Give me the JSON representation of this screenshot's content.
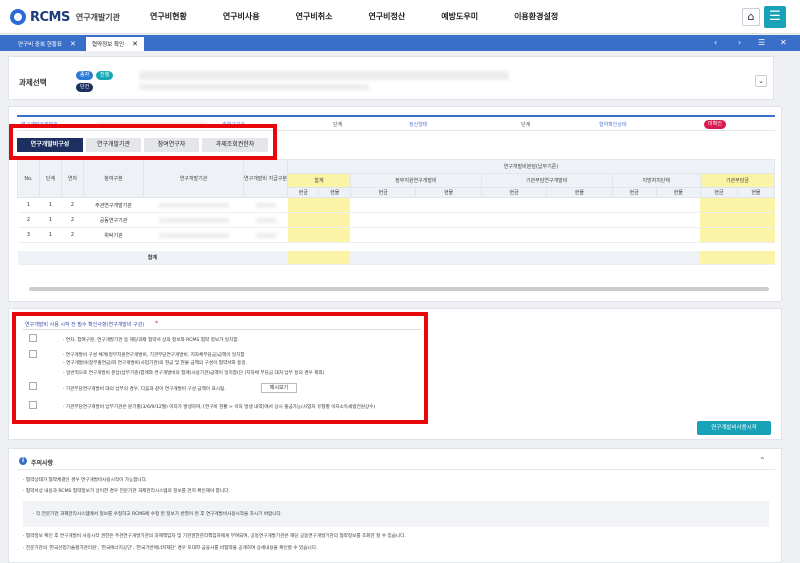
{
  "brand": {
    "name": "RCMS",
    "sub": "연구개발기관"
  },
  "menu": [
    "연구비현황",
    "연구비사용",
    "연구비취소",
    "연구비정산",
    "예방도우미",
    "이용환경설정"
  ],
  "tabs": [
    {
      "label": "연구비 중복 현황표",
      "active": false
    },
    {
      "label": "협약정보 확인",
      "active": true
    }
  ],
  "header": {
    "title": "과제선택",
    "badges": [
      {
        "label": "종자",
        "color": "#2b7bd6"
      },
      {
        "label": "진행",
        "color": "#19a9b5"
      },
      {
        "label": "단건",
        "color": "#1d2f5e"
      }
    ]
  },
  "info": {
    "lbl1": "연구개발과제번호",
    "lbl2": "총연구기간",
    "lbl3": "정산형태",
    "val3": "단계",
    "lbl4": "협약확인상태",
    "val4": "미확인",
    "lbl2b": "단계"
  },
  "subtabs": [
    "연구개발비구성",
    "연구개발기관",
    "참여연구자",
    "과제조회권한자"
  ],
  "table": {
    "group_top": "연구개발비분담(납부기준)",
    "cols": [
      "No.",
      "단계",
      "연차",
      "참여구분",
      "연구개발기관",
      "연구개발비 지급구분"
    ],
    "sub_cols": [
      "합계",
      "정부지원연구개발비",
      "기관부담연구개발비",
      "지방자치단체",
      "기관부담금",
      "기타"
    ],
    "cash": "현금",
    "inkind": "현물",
    "rows": [
      {
        "no": "1",
        "stage": "1",
        "year": "2",
        "role": "주관연구개발기관"
      },
      {
        "no": "2",
        "stage": "1",
        "year": "2",
        "role": "공동연구기관"
      },
      {
        "no": "3",
        "stage": "1",
        "year": "2",
        "role": "위탁기관"
      }
    ],
    "total_label": "합계"
  },
  "checks": {
    "title": "연구개발비 사용 시작 전 필수 확인사항(연구개발비 구성)",
    "req": "*",
    "items": [
      "· 연차, 참여구분, 연구개발기관 등 해당과제 협약서 상의 정보와 RCMS 협약 정보가 일치함.",
      "· 연구개발비 구성 체계(정부지원연구개발비, 기관부담연구개발비, 지자체부담금)금액이 일치함",
      "  - 연구개발비(정부출연금)와 연구개발비(사업기관)의 현금 및 현물 금액의 구성이 협약서와 동일.",
      "  - 일반적으로 연구개발비 분납(납부기준)합계와 연구개발비의 합계(사용기관)금액이 일치합(단 (지자체 부담금 대처 납부 등의 경우 제외)",
      "· 기관부담연구개발비 대의 납부의 경우, 다음과 같이 연구개발비 구성 금액이 표시됨.",
      "· 기관부담연구개발비 납부기관은 분기별(3/6/9/12월) 이자가 발생하며, [연구비 현황 > 이자 발생 내역]에서 상시 출금가능(사업자 유형별 이자소득세법전원상수)"
    ],
    "example_btn": "예시보기",
    "start_btn": "연구개발비사용시작"
  },
  "notice": {
    "title": "주의사항",
    "lines": [
      "· 협약상태가 협약체결인 경우 연구개발비사용시작이 가능합니다.",
      "· 협약서상 내용과 RCMS 협약정보가 상이한 경우 전문기관 과제관리시스템의 정보를 먼저 확인해야 합니다.",
      "· 각 전문기관 과제관리시스템에서 정보를 수정하고 RCMS에 수정 된 정보가 반영이 된 후 연구개발비사용시작을 하시기 바랍니다.",
      "· 협약정보 확인 후 연구개발비 사용시작 권한은 주관연구개발기관의 과제책임자 및 기관권한관리책임자에게 부여되며, 공동연구개발기관은 해당 공동연구개발기관의 협약정보를 조회만 할 수 있습니다.",
      "· 전문기관의 '한국산업기술평가관리원', '한국에너지공단', '한국기반에너지재단' 경우 모대학 금융사를 비협약을 공개하여 상세내용을 확인할 수 있습니다."
    ]
  }
}
